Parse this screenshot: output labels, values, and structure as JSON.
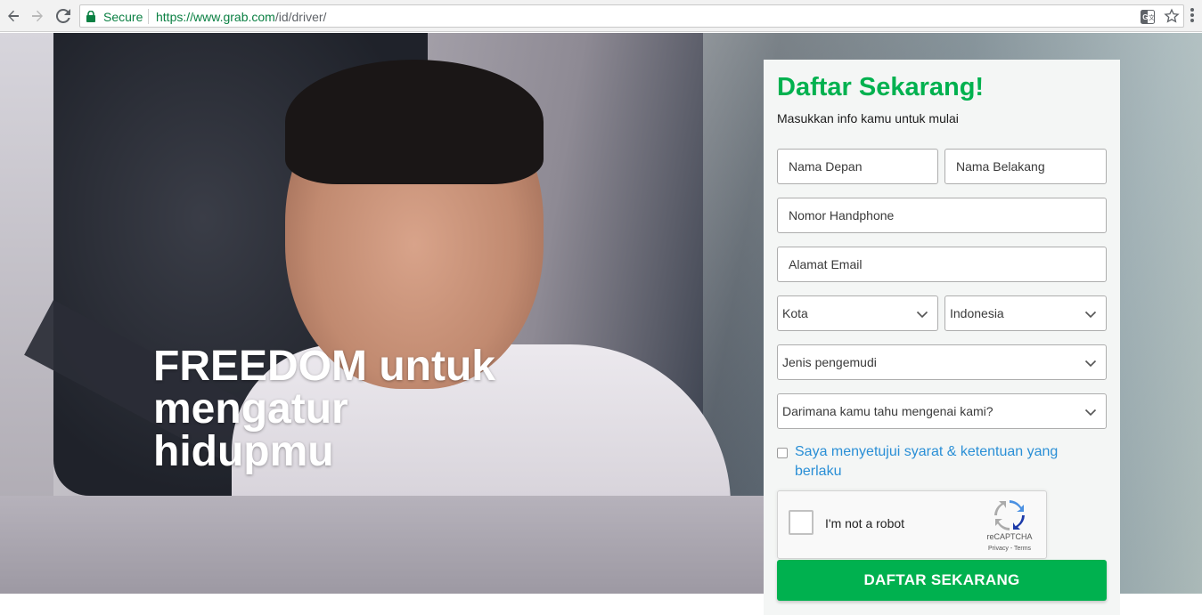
{
  "browser": {
    "secure_label": "Secure",
    "url_origin": "https://www.grab.com",
    "url_path": "/id/driver/"
  },
  "hero": {
    "headline_lines": [
      "FREEDOM untuk",
      "mengatur",
      "hidupmu"
    ]
  },
  "form": {
    "title": "Daftar Sekarang!",
    "subtitle": "Masukkan info kamu untuk mulai",
    "first_name_placeholder": "Nama Depan",
    "last_name_placeholder": "Nama Belakang",
    "phone_placeholder": "Nomor Handphone",
    "email_placeholder": "Alamat Email",
    "city_select": "Kota",
    "country_select": "Indonesia",
    "driver_type_select": "Jenis pengemudi",
    "referral_select": "Darimana kamu tahu mengenai kami?",
    "consent_text": "Saya menyetujui syarat & ketentuan yang berlaku",
    "submit_label": "DAFTAR SEKARANG"
  },
  "captcha": {
    "label": "I'm not a robot",
    "brand": "reCAPTCHA",
    "links": "Privacy - Terms"
  },
  "colors": {
    "brand_green": "#00b14f",
    "link_blue": "#2a8fd6",
    "secure_green": "#0b8043"
  },
  "icons": [
    "back-arrow-icon",
    "forward-arrow-icon",
    "reload-icon",
    "lock-icon",
    "translate-icon",
    "star-icon",
    "menu-dots-icon",
    "chevron-down-icon",
    "recaptcha-logo-icon"
  ]
}
